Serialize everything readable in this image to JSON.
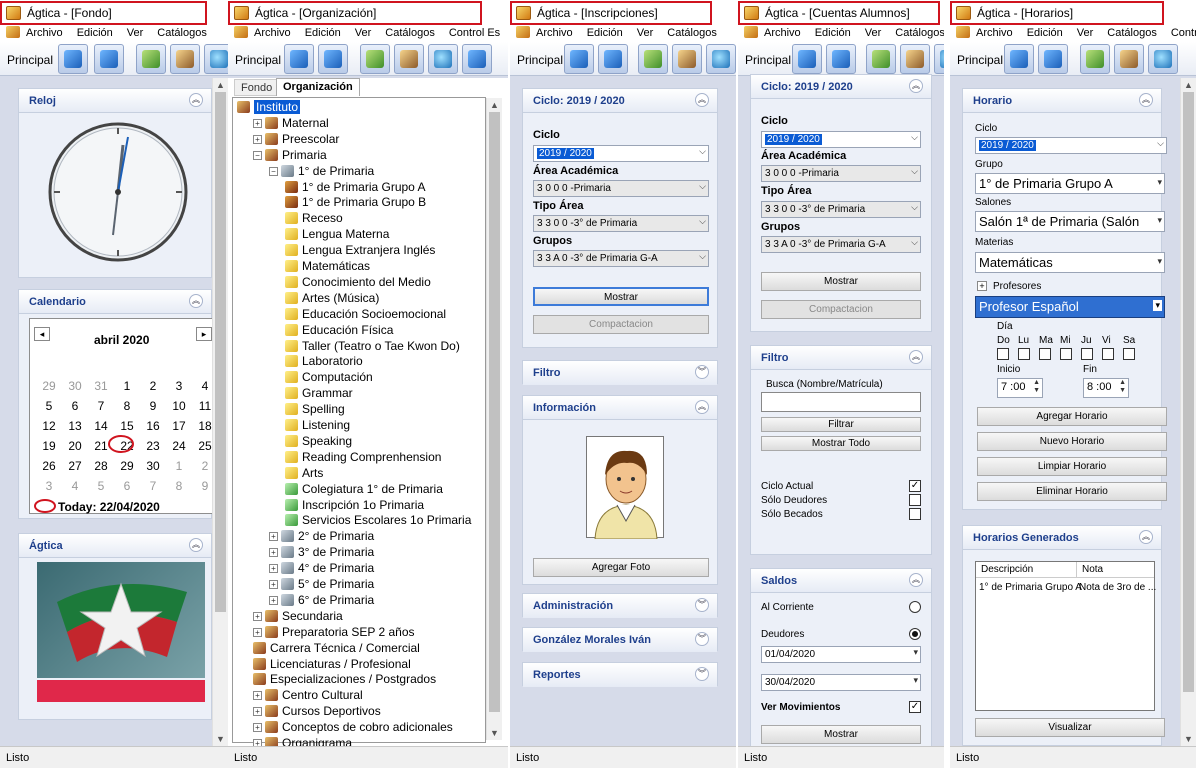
{
  "menu": {
    "archivo": "Archivo",
    "edicion": "Edición",
    "ver": "Ver",
    "catalogos": "Catálogos",
    "control": "Control Es"
  },
  "toolbar": {
    "principal": "Principal"
  },
  "status": "Listo",
  "win1": {
    "title": "Ágtica - [Fondo]",
    "reloj": "Reloj",
    "calendario": "Calendario",
    "cal_prev": "◂",
    "cal_next": "▸",
    "month": "abril 2020",
    "weeks": [
      [
        "29",
        "30",
        "31",
        "1",
        "2",
        "3",
        "4"
      ],
      [
        "5",
        "6",
        "7",
        "8",
        "9",
        "10",
        "11"
      ],
      [
        "12",
        "13",
        "14",
        "15",
        "16",
        "17",
        "18"
      ],
      [
        "19",
        "20",
        "21",
        "22",
        "23",
        "24",
        "25"
      ],
      [
        "26",
        "27",
        "28",
        "29",
        "30",
        "1",
        "2"
      ],
      [
        "3",
        "4",
        "5",
        "6",
        "7",
        "8",
        "9"
      ]
    ],
    "today": "Today: 22/04/2020",
    "agtica": "Ágtica"
  },
  "win2": {
    "title": "Ágtica - [Organización]",
    "tab_fondo": "Fondo",
    "tab_org": "Organización",
    "tree": [
      {
        "t": "Instituto",
        "sel": true
      },
      {
        "t": "Maternal"
      },
      {
        "t": "Preescolar"
      },
      {
        "t": "Primaria"
      },
      {
        "t": "1° de Primaria"
      },
      {
        "t": "1° de Primaria Grupo A"
      },
      {
        "t": "1° de Primaria Grupo B"
      },
      {
        "t": "Receso"
      },
      {
        "t": "Lengua Materna"
      },
      {
        "t": "Lengua Extranjera Inglés"
      },
      {
        "t": "Matemáticas"
      },
      {
        "t": "Conocimiento del Medio"
      },
      {
        "t": "Artes (Música)"
      },
      {
        "t": "Educación Socioemocional"
      },
      {
        "t": "Educación Física"
      },
      {
        "t": "Taller (Teatro o Tae Kwon Do)"
      },
      {
        "t": "Laboratorio"
      },
      {
        "t": "Computación"
      },
      {
        "t": "Grammar"
      },
      {
        "t": "Spelling"
      },
      {
        "t": "Listening"
      },
      {
        "t": "Speaking"
      },
      {
        "t": "Reading Comprenhension"
      },
      {
        "t": "Arts"
      },
      {
        "t": "Colegiatura 1° de Primaria"
      },
      {
        "t": "Inscripción 1o Primaria"
      },
      {
        "t": "Servicios Escolares 1o Primaria"
      },
      {
        "t": "2° de Primaria"
      },
      {
        "t": "3° de Primaria"
      },
      {
        "t": "4° de Primaria"
      },
      {
        "t": "5° de Primaria"
      },
      {
        "t": "6° de Primaria"
      },
      {
        "t": "Secundaria"
      },
      {
        "t": "Preparatoria  SEP 2 años"
      },
      {
        "t": "Carrera Técnica / Comercial"
      },
      {
        "t": "Licenciaturas / Profesional"
      },
      {
        "t": "Especializaciones / Postgrados"
      },
      {
        "t": "Centro Cultural"
      },
      {
        "t": "Cursos Deportivos"
      },
      {
        "t": "Conceptos de cobro adicionales"
      },
      {
        "t": "Organigrama"
      }
    ]
  },
  "win3": {
    "title": "Ágtica - [Inscripciones]",
    "ciclo_head": "Ciclo: 2019 / 2020",
    "ciclo": "Ciclo",
    "ciclo_val": "2019 / 2020",
    "area": "Área Académica",
    "area_val": "3 0 0 0 -Primaria",
    "tipo": "Tipo Área",
    "tipo_val": "3 3 0 0 -3° de Primaria",
    "grupos": "Grupos",
    "grupos_val": "3 3 A 0 -3° de Primaria G-A",
    "mostrar": "Mostrar",
    "compactacion": "Compactacion",
    "filtro": "Filtro",
    "informacion": "Información",
    "agregar_foto": "Agregar Foto",
    "administracion": "Administración",
    "persona": "González Morales Iván",
    "reportes": "Reportes"
  },
  "win4": {
    "title": "Ágtica - [Cuentas Alumnos]",
    "ciclo_head": "Ciclo: 2019 / 2020",
    "ciclo": "Ciclo",
    "ciclo_val": "2019 / 2020",
    "area": "Área Académica",
    "area_val": "3 0 0 0 -Primaria",
    "tipo": "Tipo Área",
    "tipo_val": "3 3 0 0 -3° de Primaria",
    "grupos": "Grupos",
    "grupos_val": "3 3 A 0 -3° de Primaria G-A",
    "mostrar": "Mostrar",
    "compactacion": "Compactacion",
    "filtro": "Filtro",
    "busca": "Busca (Nombre/Matrícula)",
    "filtrar": "Filtrar",
    "mostrar_todo": "Mostrar Todo",
    "ciclo_actual": "Ciclo Actual",
    "solo_deudores": "Sólo Deudores",
    "solo_becados": "Sólo Becados",
    "saldos": "Saldos",
    "al_corriente": "Al Corriente",
    "deudores": "Deudores",
    "fecha1": "01/04/2020",
    "fecha2": "30/04/2020",
    "ver_mov": "Ver Movimientos",
    "mostrar2": "Mostrar"
  },
  "win5": {
    "title": "Ágtica - [Horarios]",
    "horario": "Horario",
    "ciclo": "Ciclo",
    "ciclo_val": "2019 / 2020",
    "grupo": "Grupo",
    "grupo_val": "1° de Primaria Grupo A",
    "salones": "Salones",
    "salon_val": "Salón 1ª de Primaria (Salón",
    "materias": "Materias",
    "materia_val": "Matemáticas",
    "profesores": "Profesores",
    "profesor_val": "Profesor Español",
    "dia": "Día",
    "days": [
      "Do",
      "Lu",
      "Ma",
      "Mi",
      "Ju",
      "Vi",
      "Sa"
    ],
    "inicio": "Inicio",
    "fin": "Fin",
    "inicio_val": "7 :00",
    "fin_val": "8 :00",
    "agregar": "Agregar Horario",
    "nuevo": "Nuevo Horario",
    "limpiar": "Limpiar Horario",
    "eliminar": "Eliminar Horario",
    "generados": "Horarios Generados",
    "col_desc": "Descripción",
    "col_nota": "Nota",
    "row_desc": "1° de Primaria Grupo A",
    "row_nota": "Nota de 3ro de ...",
    "visualizar": "Visualizar"
  }
}
